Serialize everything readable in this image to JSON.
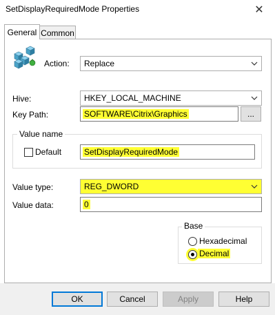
{
  "window": {
    "title": "SetDisplayRequiredMode Properties",
    "close_glyph": "✕"
  },
  "tabs": [
    {
      "label": "General",
      "active": true
    },
    {
      "label": "Common",
      "active": false
    }
  ],
  "action": {
    "label": "Action:",
    "value": "Replace",
    "icon": "registry-cubes-icon"
  },
  "hive": {
    "label": "Hive:",
    "value": "HKEY_LOCAL_MACHINE"
  },
  "key_path": {
    "label": "Key Path:",
    "value": "SOFTWARE\\Citrix\\Graphics",
    "browse_label": "..."
  },
  "value_name": {
    "group_label": "Value name",
    "default_label": "Default",
    "default_checked": false,
    "value": "SetDisplayRequiredMode"
  },
  "value_type": {
    "label": "Value type:",
    "value": "REG_DWORD"
  },
  "value_data": {
    "label": "Value data:",
    "value": "0"
  },
  "base": {
    "group_label": "Base",
    "options": [
      {
        "label": "Hexadecimal",
        "selected": false
      },
      {
        "label": "Decimal",
        "selected": true
      }
    ]
  },
  "buttons": {
    "ok": "OK",
    "cancel": "Cancel",
    "apply": "Apply",
    "help": "Help"
  },
  "colors": {
    "highlight": "#ffff33",
    "default_button_border": "#0078d7"
  }
}
